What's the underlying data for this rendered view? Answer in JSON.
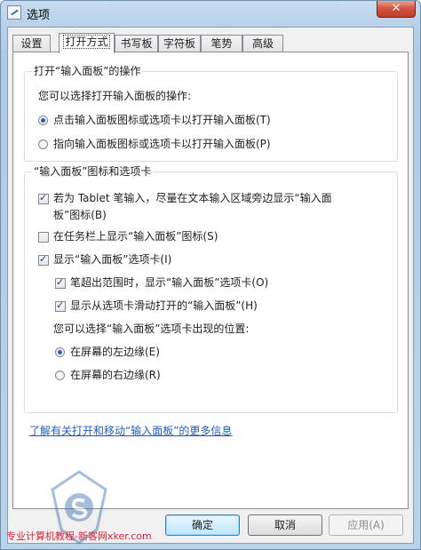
{
  "window": {
    "title": "选项",
    "close_symbol": "✕"
  },
  "tabs": [
    {
      "label": "设置"
    },
    {
      "label": "打开方式"
    },
    {
      "label": "书写板"
    },
    {
      "label": "字符板"
    },
    {
      "label": "笔势"
    },
    {
      "label": "高级"
    }
  ],
  "open_group": {
    "title": "打开“输入面板”的操作",
    "description": "您可以选择打开输入面板的操作:",
    "options": [
      {
        "label": "点击输入面板图标或选项卡以打开输入面板(T)",
        "selected": true
      },
      {
        "label": "指向输入面板图标或选项卡以打开输入面板(P)",
        "selected": false
      }
    ]
  },
  "icon_group": {
    "title": "“输入面板”图标和选项卡",
    "tablet_checkbox": {
      "line1": "若为 Tablet 笔输入，尽量在文本输入区域旁边显示“输入面",
      "line2": "板”图标(B)",
      "checked": true
    },
    "taskbar_checkbox": {
      "label": "在任务栏上显示“输入面板”图标(S)",
      "checked": false
    },
    "show_tab_checkbox": {
      "label": "显示“输入面板”选项卡(I)",
      "checked": true
    },
    "pen_out_checkbox": {
      "label": "笔超出范围时，显示“输入面板”选项卡(O)",
      "checked": true
    },
    "slide_checkbox": {
      "label": "显示从选项卡滑动打开的“输入面板”(H)",
      "checked": true
    },
    "position_prompt": "您可以选择“输入面板”选项卡出现的位置:",
    "position_options": [
      {
        "label": "在屏幕的左边缘(E)",
        "selected": true
      },
      {
        "label": "在屏幕的右边缘(R)",
        "selected": false
      }
    ]
  },
  "more_info_link": "了解有关打开和移动“输入面板”的更多信息",
  "buttons": {
    "ok": "确定",
    "cancel": "取消",
    "apply": "应用(A)"
  },
  "watermark": "专业计算机教程-新客网xker.com"
}
